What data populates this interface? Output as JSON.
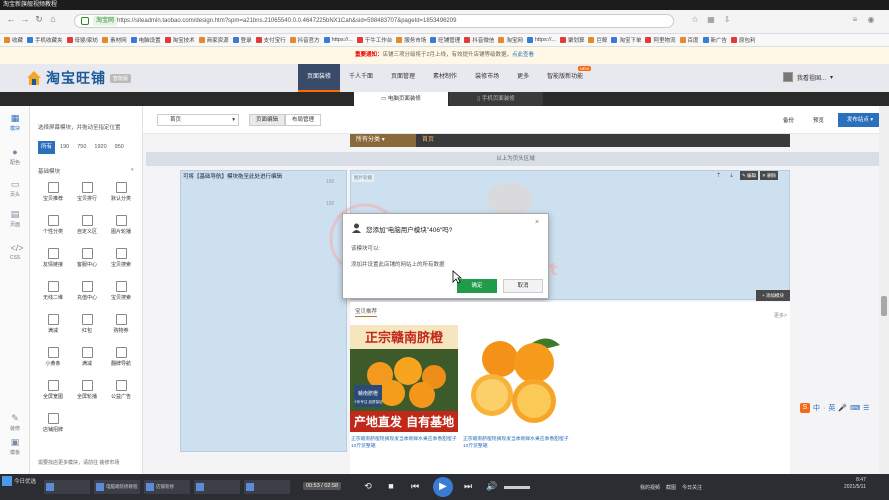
{
  "video_title": "淘宝新旗舰视频教程",
  "browser": {
    "site_badge": "淘宝网",
    "url": "https://siteadmin.taobao.com/design.htm?spm=a21bns.21065540.0.0.4647225bNX1Cah&sid=598483707&pageId=1853496209",
    "bookmarks": [
      "收藏",
      "手机收藏夹",
      "母婴/家纺",
      "素材网",
      "电脑设置",
      "淘宝技术",
      "商家资源",
      "登录",
      "支付宝行",
      "抖音官方",
      "https://...",
      "干牛工作台",
      "服务市场",
      "旺铺管理",
      "抖音微信",
      "淘宝网",
      "https://...",
      "聚划算",
      "巨鲸",
      "淘宝下单",
      "阿里物流",
      "百度",
      "新广告",
      "原包利"
    ]
  },
  "notice": {
    "prefix": "重要通知：",
    "text": "店铺三项分级将于2月上线，有效提升店铺等级数据，",
    "link": "点此查看"
  },
  "app": {
    "logo_text": "淘宝旺铺",
    "version": "智能版",
    "nav": [
      "页面装修",
      "千人千面",
      "页面管理",
      "素材制作",
      "装修市场",
      "更多",
      "智能版新功能"
    ],
    "nav_hot": "NEW",
    "user": "我看祖国..."
  },
  "subtabs": {
    "pc": "电脑页面装修",
    "mobile": "手机页面装修"
  },
  "leftcol": [
    "模块",
    "配色",
    "页头",
    "页面",
    "CSS",
    "装修",
    "模板"
  ],
  "modpanel": {
    "hint": "选择屏幕模块，并拖动至指定位置",
    "widths": [
      "所有",
      "190",
      "750",
      "1920",
      "950"
    ],
    "section": "基础模块",
    "modules": [
      "宝贝推荐",
      "宝贝排行",
      "默认分类",
      "个性分类",
      "自定义区",
      "图片轮播",
      "友情链接",
      "客服中心",
      "宝贝搜索",
      "无线二维",
      "充值中心",
      "宝贝搜索",
      "满减",
      "红包",
      "购物券",
      "小黄条",
      "满减",
      "翻牌导航",
      "全屏宽图",
      "全屏轮播",
      "公益广告",
      "店铺招牌"
    ],
    "footer": "需要找店更多模块，请前往 装修市场"
  },
  "toolbar": {
    "page_select": "首页",
    "page_edit": "页面编辑",
    "layout": "布局管理",
    "backup": "备份",
    "preview": "预览",
    "publish": "发布站点"
  },
  "store": {
    "category_btn": "所有分类",
    "home_btn": "首页",
    "header_band": "以上为页头区域",
    "left_placeholder": "可将【基础导航】模块拖至此处进行编辑",
    "left_nums": [
      "190",
      "190"
    ],
    "right_tag": "图片轮播",
    "edit": "编辑",
    "delete": "删除",
    "add_module": "添加模块"
  },
  "dialog": {
    "title": "您添加\"电脑用户模块\"406\"吗?",
    "line1": "该模块可以:",
    "line2": "添加并设置此店铺的网站上的所有数据",
    "ok": "确定",
    "cancel": "取消"
  },
  "watermark": {
    "brand": "TB58论坛",
    "url": "www.tb58.net"
  },
  "products": {
    "title": "宝贝推荐",
    "more": "更多>",
    "img1_top": "正宗赣南脐橙",
    "img1_bottom": "产地直发 自有基地",
    "img1_tag": "赣南脐橙",
    "img1_sub": "十年专注 品质保证",
    "items": [
      "正宗赣南脐橙现摘现发当季新鲜水果应季香甜橙子10斤装整箱",
      "正宗赣南脐橙现摘现发当季新鲜水果应季香甜橙子10斤装整箱"
    ]
  },
  "player": {
    "start": "今日优选",
    "tasks": [
      "电脑端装修教程",
      "店铺装修"
    ],
    "time": "00:53 / 02:58",
    "sys": [
      "我的视频",
      "截图",
      "今日关注"
    ],
    "clock_time": "8:47",
    "clock_date": "2021/5/11"
  },
  "ime": [
    "中",
    "·",
    "英",
    "🎤",
    "⌨",
    "☰"
  ],
  "colors": {
    "accent": "#2b6fbd",
    "nav_active": "#3a4a6a",
    "orange": "#ff6a00",
    "ok_green": "#1f9b4a"
  }
}
